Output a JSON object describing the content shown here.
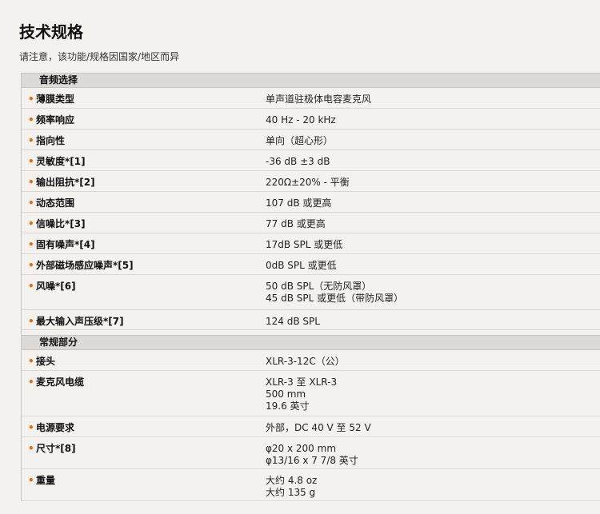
{
  "page": {
    "title": "技术规格",
    "note": "请注意，该功能/规格因国家/地区而异"
  },
  "bullet": "•",
  "sections": [
    {
      "title": "音频选择",
      "rows": [
        {
          "label": "薄膜类型",
          "values": [
            "单声道驻极体电容麦克风"
          ]
        },
        {
          "label": "频率响应",
          "values": [
            "40 Hz - 20 kHz"
          ]
        },
        {
          "label": "指向性",
          "values": [
            "单向（超心形）"
          ]
        },
        {
          "label": "灵敏度*[1]",
          "values": [
            "-36 dB ±3 dB"
          ]
        },
        {
          "label": "输出阻抗*[2]",
          "values": [
            "220Ω±20% - 平衡"
          ]
        },
        {
          "label": "动态范围",
          "values": [
            "107 dB 或更高"
          ]
        },
        {
          "label": "信噪比*[3]",
          "values": [
            "77 dB 或更高"
          ]
        },
        {
          "label": "固有噪声*[4]",
          "values": [
            "17dB SPL 或更低"
          ]
        },
        {
          "label": "外部磁场感应噪声*[5]",
          "values": [
            "0dB SPL 或更低"
          ]
        },
        {
          "label": "风噪*[6]",
          "values": [
            "50 dB SPL（无防风罩）",
            "45 dB SPL 或更低（带防风罩）"
          ]
        },
        {
          "label": "最大输入声压级*[7]",
          "values": [
            "124 dB SPL"
          ]
        }
      ]
    },
    {
      "title": "常规部分",
      "rows": [
        {
          "label": "接头",
          "values": [
            "XLR-3-12C（公）"
          ]
        },
        {
          "label": "麦克风电缆",
          "values": [
            "XLR-3 至 XLR-3",
            "500 mm",
            "19.6 英寸"
          ]
        },
        {
          "label": "电源要求",
          "values": [
            "外部，DC 40 V 至 52 V"
          ]
        },
        {
          "label": "尺寸*[8]",
          "values": [
            "φ20 x 200 mm",
            "φ13/16 x 7 7/8 英寸"
          ]
        },
        {
          "label": "重量",
          "values": [
            "大约 4.8 oz",
            "大约 135 g"
          ]
        }
      ]
    }
  ]
}
